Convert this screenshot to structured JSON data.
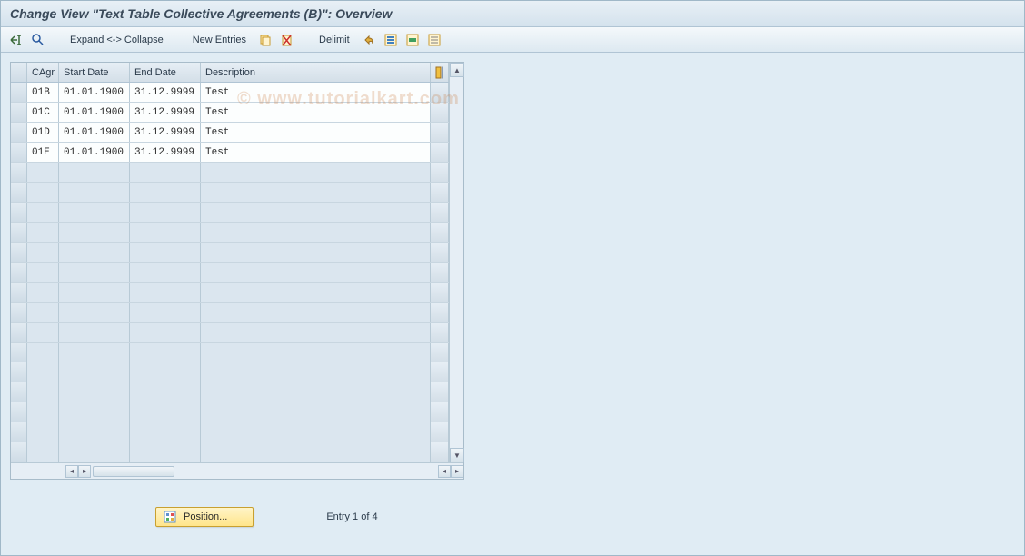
{
  "title": "Change View \"Text Table Collective Agreements (B)\": Overview",
  "toolbar": {
    "expand_collapse": "Expand <-> Collapse",
    "new_entries": "New Entries",
    "delimit": "Delimit"
  },
  "table": {
    "headers": {
      "cagr": "CAgr",
      "start": "Start Date",
      "end": "End Date",
      "desc": "Description"
    },
    "rows": [
      {
        "cagr": "01B",
        "start": "01.01.1900",
        "end": "31.12.9999",
        "desc": "Test"
      },
      {
        "cagr": "01C",
        "start": "01.01.1900",
        "end": "31.12.9999",
        "desc": "Test"
      },
      {
        "cagr": "01D",
        "start": "01.01.1900",
        "end": "31.12.9999",
        "desc": "Test"
      },
      {
        "cagr": "01E",
        "start": "01.01.1900",
        "end": "31.12.9999",
        "desc": "Test"
      }
    ],
    "empty_row_count": 15
  },
  "footer": {
    "position_label": "Position...",
    "entry_status": "Entry 1 of 4"
  },
  "watermark": "© www.tutorialkart.com"
}
